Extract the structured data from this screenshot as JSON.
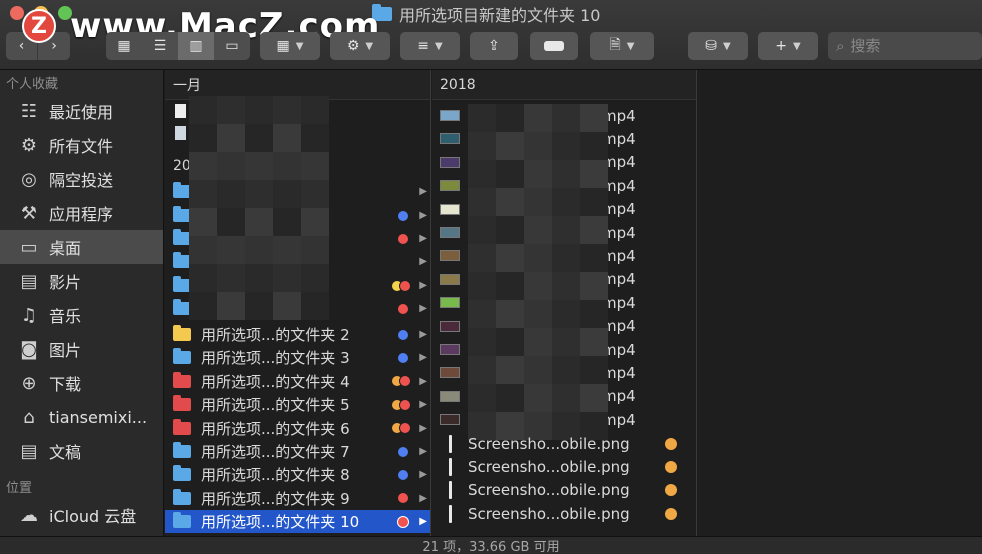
{
  "window": {
    "title": "用所选项目新建的文件夹 10",
    "watermark": "www.MacZ.com",
    "logo_letter": "Z"
  },
  "colors": {
    "close": "#ed6a5e",
    "minimize": "#f5bf4f",
    "zoom": "#61c454",
    "selection": "#2357c9",
    "folder_blue": "#5aa9e6",
    "folder_red": "#e24b4b",
    "folder_yellow": "#f3c94f",
    "tag_blue": "#4f7ff0",
    "tag_red": "#ef5350",
    "tag_orange": "#f0a845",
    "tag_yellow": "#f4d34a"
  },
  "toolbar": {
    "back_icon": "chevron-left-icon",
    "forward_icon": "chevron-right-icon",
    "search_placeholder": "搜索"
  },
  "sidebar": {
    "favorites_header": "个人收藏",
    "favorites": [
      {
        "label": "最近使用",
        "icon": "recents-icon"
      },
      {
        "label": "所有文件",
        "icon": "gear-icon"
      },
      {
        "label": "隔空投送",
        "icon": "airdrop-icon"
      },
      {
        "label": "应用程序",
        "icon": "applications-icon"
      },
      {
        "label": "桌面",
        "icon": "desktop-icon",
        "selected": true
      },
      {
        "label": "影片",
        "icon": "film-icon"
      },
      {
        "label": "音乐",
        "icon": "music-icon"
      },
      {
        "label": "图片",
        "icon": "camera-icon"
      },
      {
        "label": "下载",
        "icon": "download-icon"
      },
      {
        "label": "tiansemixi...",
        "icon": "home-icon"
      },
      {
        "label": "文稿",
        "icon": "documents-icon"
      }
    ],
    "locations_header": "位置",
    "locations": [
      {
        "label": "iCloud 云盘",
        "icon": "cloud-icon"
      }
    ]
  },
  "column1": {
    "header": "一月",
    "subheader": "20",
    "folders": [
      {
        "name": "用所选项...的文件夹 2",
        "color": "yellow",
        "tags": [
          "blue"
        ]
      },
      {
        "name": "用所选项...的文件夹 3",
        "color": "blue",
        "tags": [
          "blue"
        ]
      },
      {
        "name": "用所选项...的文件夹 4",
        "color": "red",
        "tags": [
          "orange",
          "red"
        ]
      },
      {
        "name": "用所选项...的文件夹 5",
        "color": "red",
        "tags": [
          "orange",
          "red"
        ]
      },
      {
        "name": "用所选项...的文件夹 6",
        "color": "red",
        "tags": [
          "orange",
          "red"
        ]
      },
      {
        "name": "用所选项...的文件夹 7",
        "color": "blue",
        "tags": [
          "blue"
        ]
      },
      {
        "name": "用所选项...的文件夹 8",
        "color": "blue",
        "tags": [
          "blue"
        ]
      },
      {
        "name": "用所选项...的文件夹 9",
        "color": "blue",
        "tags": [
          "red"
        ]
      },
      {
        "name": "用所选项...的文件夹 10",
        "color": "blue",
        "tags": [
          "red"
        ],
        "selected": true
      }
    ]
  },
  "column2": {
    "header": "2018",
    "video_suffix": "mp4",
    "videos": [
      "#7aa6c9",
      "#2f5e6e",
      "#4a3b6a",
      "#7b8a3d",
      "#e6e6d0",
      "#557785",
      "#7a5e3e",
      "#8a7a4a",
      "#79b84a",
      "#4a2a3a",
      "#5a3a5e",
      "#6e4a3a",
      "#8a8a7a",
      "#3a2a2a"
    ],
    "pngs": [
      "Screensho...obile.png",
      "Screensho...obile.png",
      "Screensho...obile.png",
      "Screensho...obile.png"
    ]
  },
  "status": {
    "text": "21 项，33.66 GB 可用"
  }
}
